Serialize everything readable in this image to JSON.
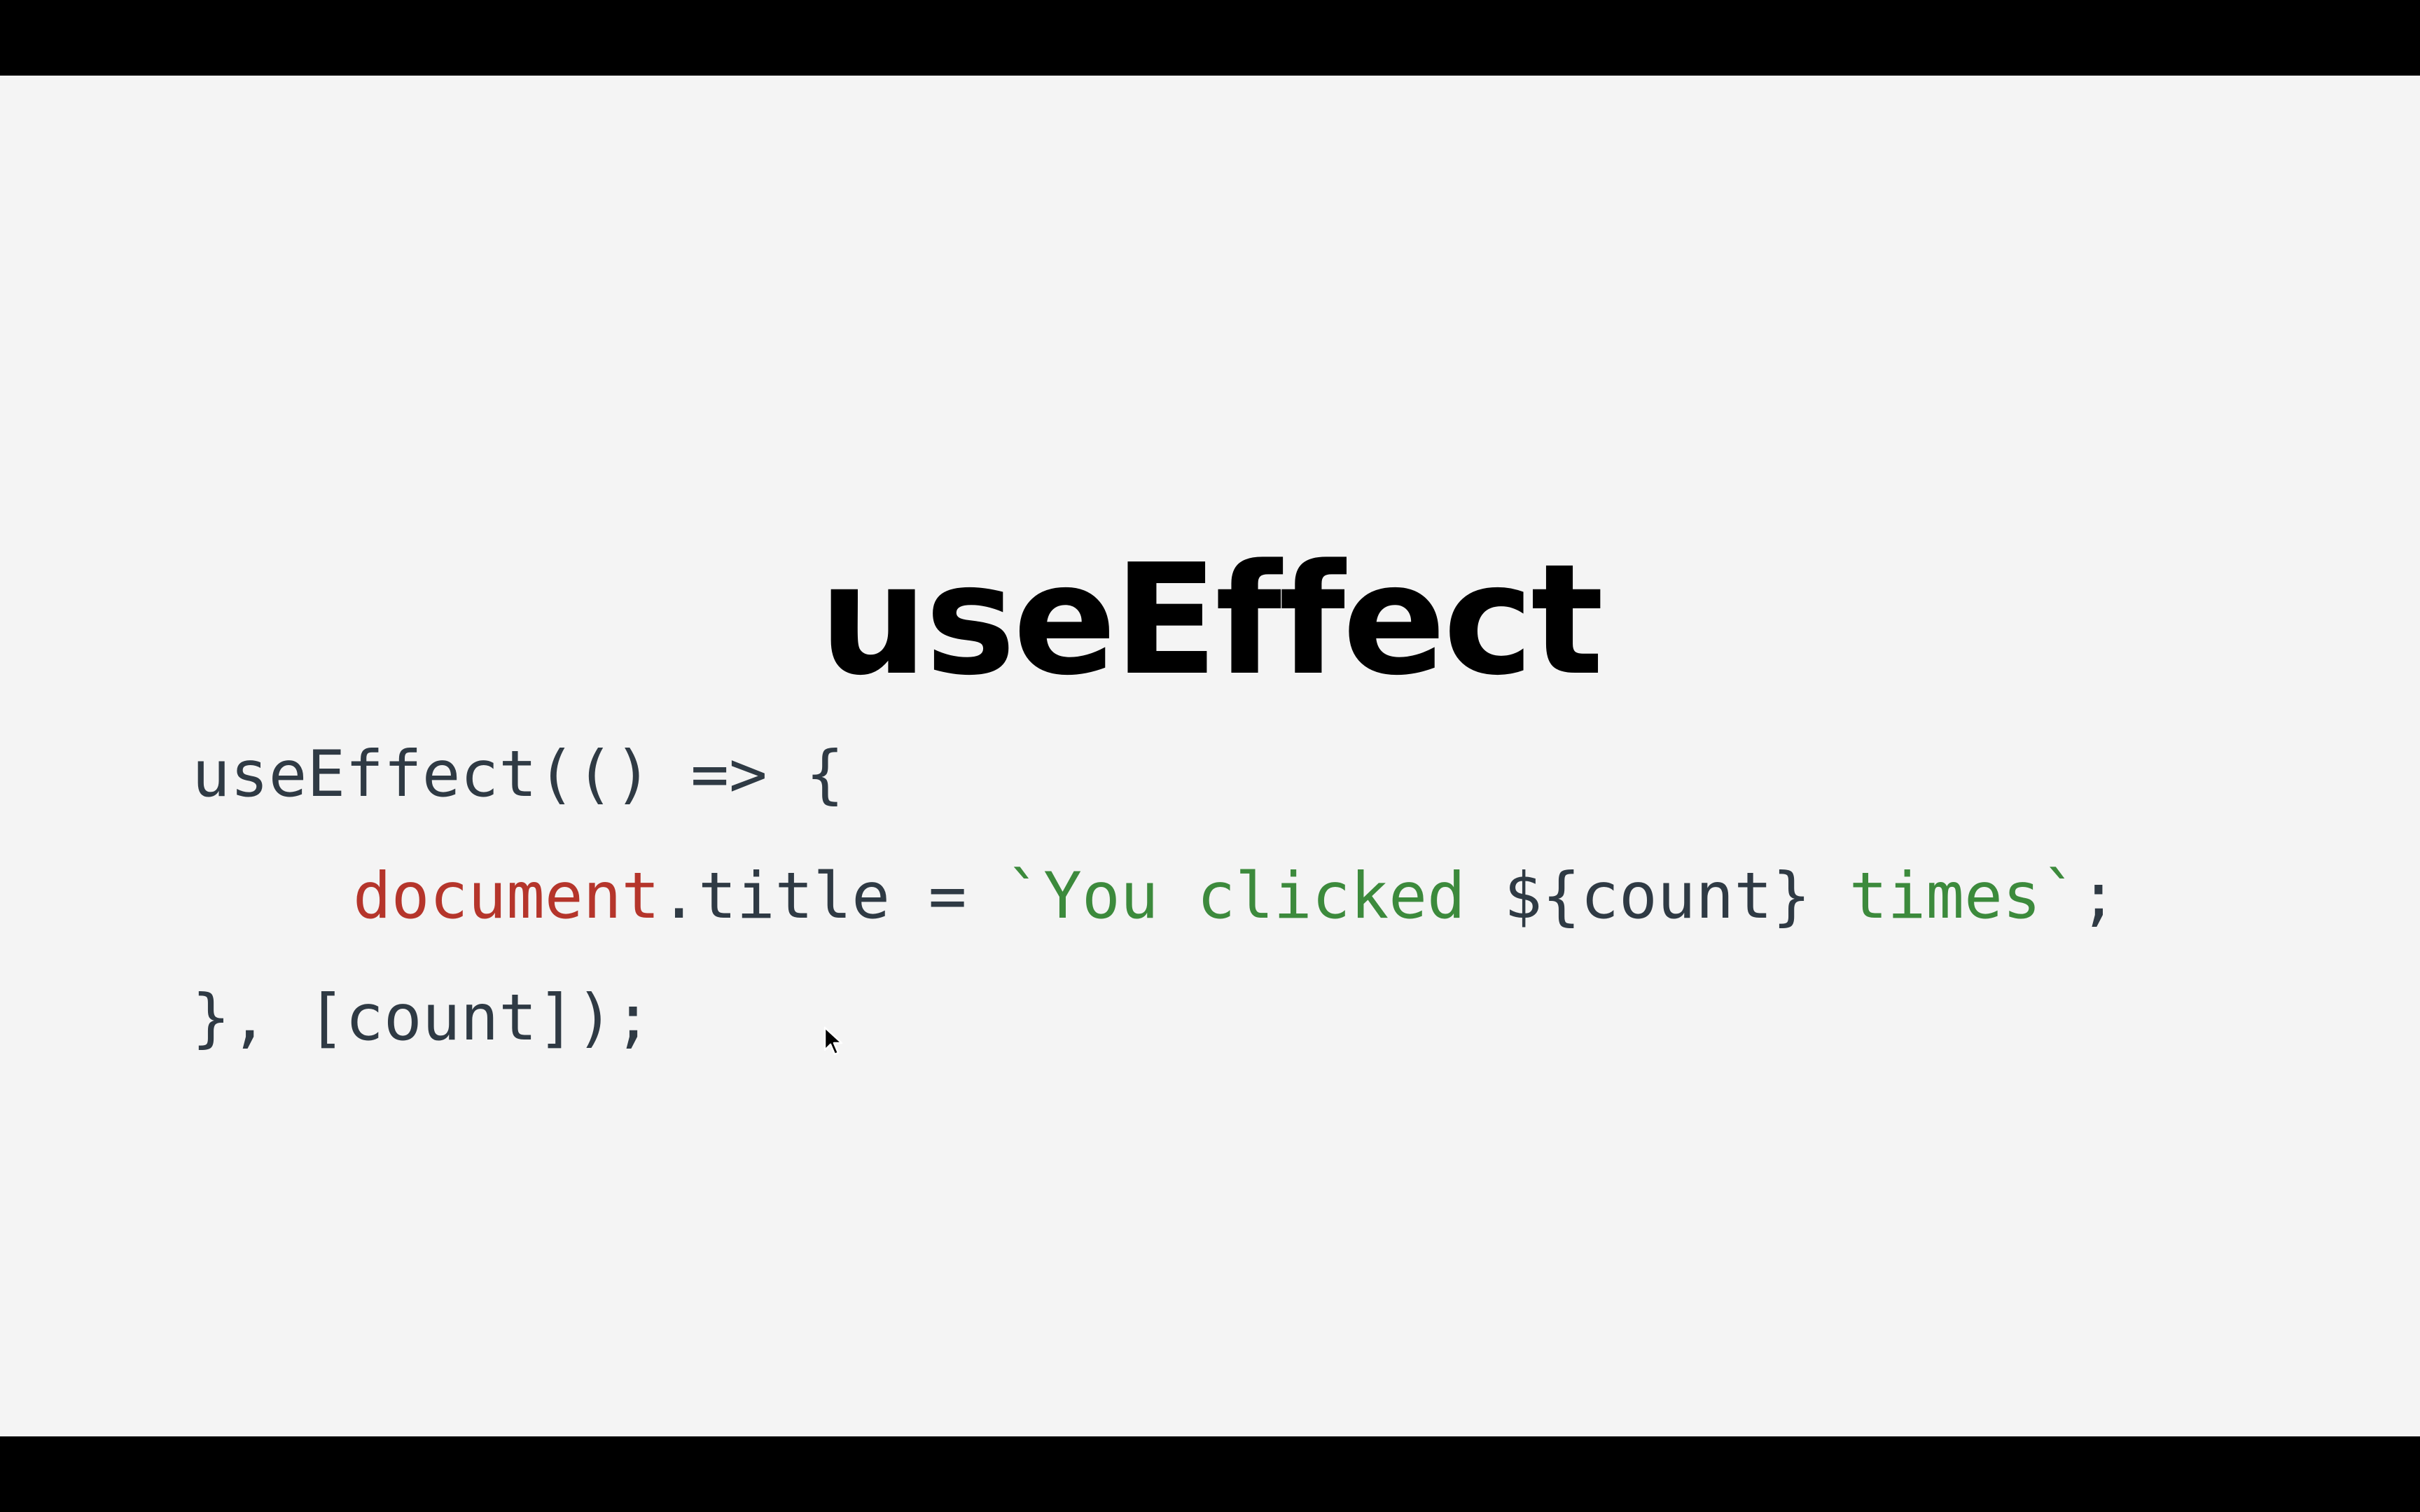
{
  "slide": {
    "title": "useEffect",
    "code": {
      "line1": "useEffect(() => {",
      "line2": {
        "obj": "document",
        "prop": ".title = ",
        "str_open": "`You clicked ",
        "interp": "${count}",
        "str_close": " times`",
        "end": ";"
      },
      "line3": "}, [count]);"
    }
  },
  "colors": {
    "background": "#f4f4f4",
    "letterbox": "#000000",
    "text": "#2f3a44",
    "builtin": "#b5352b",
    "string": "#3c8a3c"
  },
  "icons": {
    "cursor": "mouse-pointer-icon"
  }
}
